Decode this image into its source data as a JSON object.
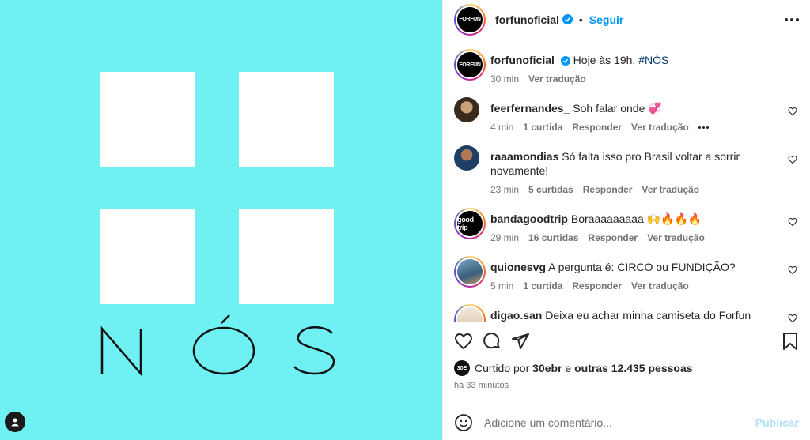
{
  "media": {
    "title_letters": [
      "N",
      "Ó",
      "S"
    ],
    "background": "#6ff0f2"
  },
  "header": {
    "username": "forfunoficial",
    "separator": "•",
    "follow_label": "Seguir",
    "avatar_text": "FORFUN"
  },
  "caption": {
    "username": "forfunoficial",
    "text": "Hoje às 19h.",
    "hashtag": "#NÓS",
    "time": "30 min",
    "translate": "Ver tradução"
  },
  "comments": [
    {
      "username": "feerfernandes_",
      "text": "Soh falar onde 💞",
      "time": "4 min",
      "likes": "1 curtida",
      "reply": "Responder",
      "translate": "Ver tradução"
    },
    {
      "username": "raaamondias",
      "text": "Só falta isso pro Brasil voltar a sorrir novamente!",
      "time": "23 min",
      "likes": "5 curtidas",
      "reply": "Responder",
      "translate": "Ver tradução"
    },
    {
      "username": "bandagoodtrip",
      "text": "Boraaaaaaaaa 🙌🔥🔥🔥",
      "time": "29 min",
      "likes": "16 curtidas",
      "reply": "Responder",
      "translate": "Ver tradução"
    },
    {
      "username": "quionesvg",
      "text": "A pergunta é: CIRCO ou FUNDIÇÃO?",
      "time": "5 min",
      "likes": "1 curtida",
      "reply": "Responder",
      "translate": "Ver tradução"
    },
    {
      "username": "digao.san",
      "text": "Deixa eu achar minha camiseta do Forfun aqui..."
    }
  ],
  "likes": {
    "prefix": "Curtido por",
    "user": "30ebr",
    "middle": "e",
    "others": "outras 12.435 pessoas",
    "avatar_text": "30E",
    "ago": "há 33 minutos"
  },
  "add_comment": {
    "placeholder": "Adicione um comentário...",
    "publish_label": "Publicar"
  },
  "colors": {
    "accent": "#0095f6",
    "verified": "#0095f6",
    "muted": "#737373"
  }
}
